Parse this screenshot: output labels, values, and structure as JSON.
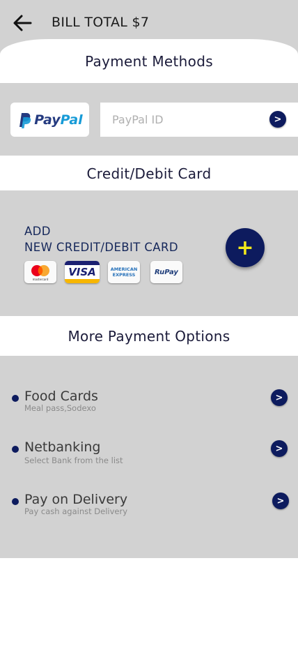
{
  "header": {
    "title": "BILL TOTAL $7",
    "back_icon": "arrow-left-icon"
  },
  "sections": {
    "payment_methods": "Payment Methods",
    "credit_debit": "Credit/Debit Card",
    "more_options": "More Payment Options"
  },
  "paypal": {
    "logo_text_1": "Pay",
    "logo_text_2": "Pal",
    "input_placeholder": "PayPal ID",
    "go_label": ">"
  },
  "add_card": {
    "line1": "ADD",
    "line2": "NEW CREDIT/DEBIT CARD",
    "button_label": "+",
    "card_logos": [
      "mastercard",
      "VISA",
      "AMERICAN EXPRESS",
      "RuPay"
    ]
  },
  "more_options": [
    {
      "title": "Food Cards",
      "subtitle": "Meal pass,Sodexo",
      "go_label": ">"
    },
    {
      "title": "Netbanking",
      "subtitle": "Select Bank from the list",
      "go_label": ">"
    },
    {
      "title": "Pay on Delivery",
      "subtitle": "Pay cash against Delivery",
      "go_label": ">"
    }
  ],
  "colors": {
    "navy": "#0d1b5e",
    "panel_gray": "#d2d2d2",
    "plus_yellow": "#f3e91b",
    "paypal_dark": "#253b80",
    "paypal_light": "#179bd7"
  }
}
